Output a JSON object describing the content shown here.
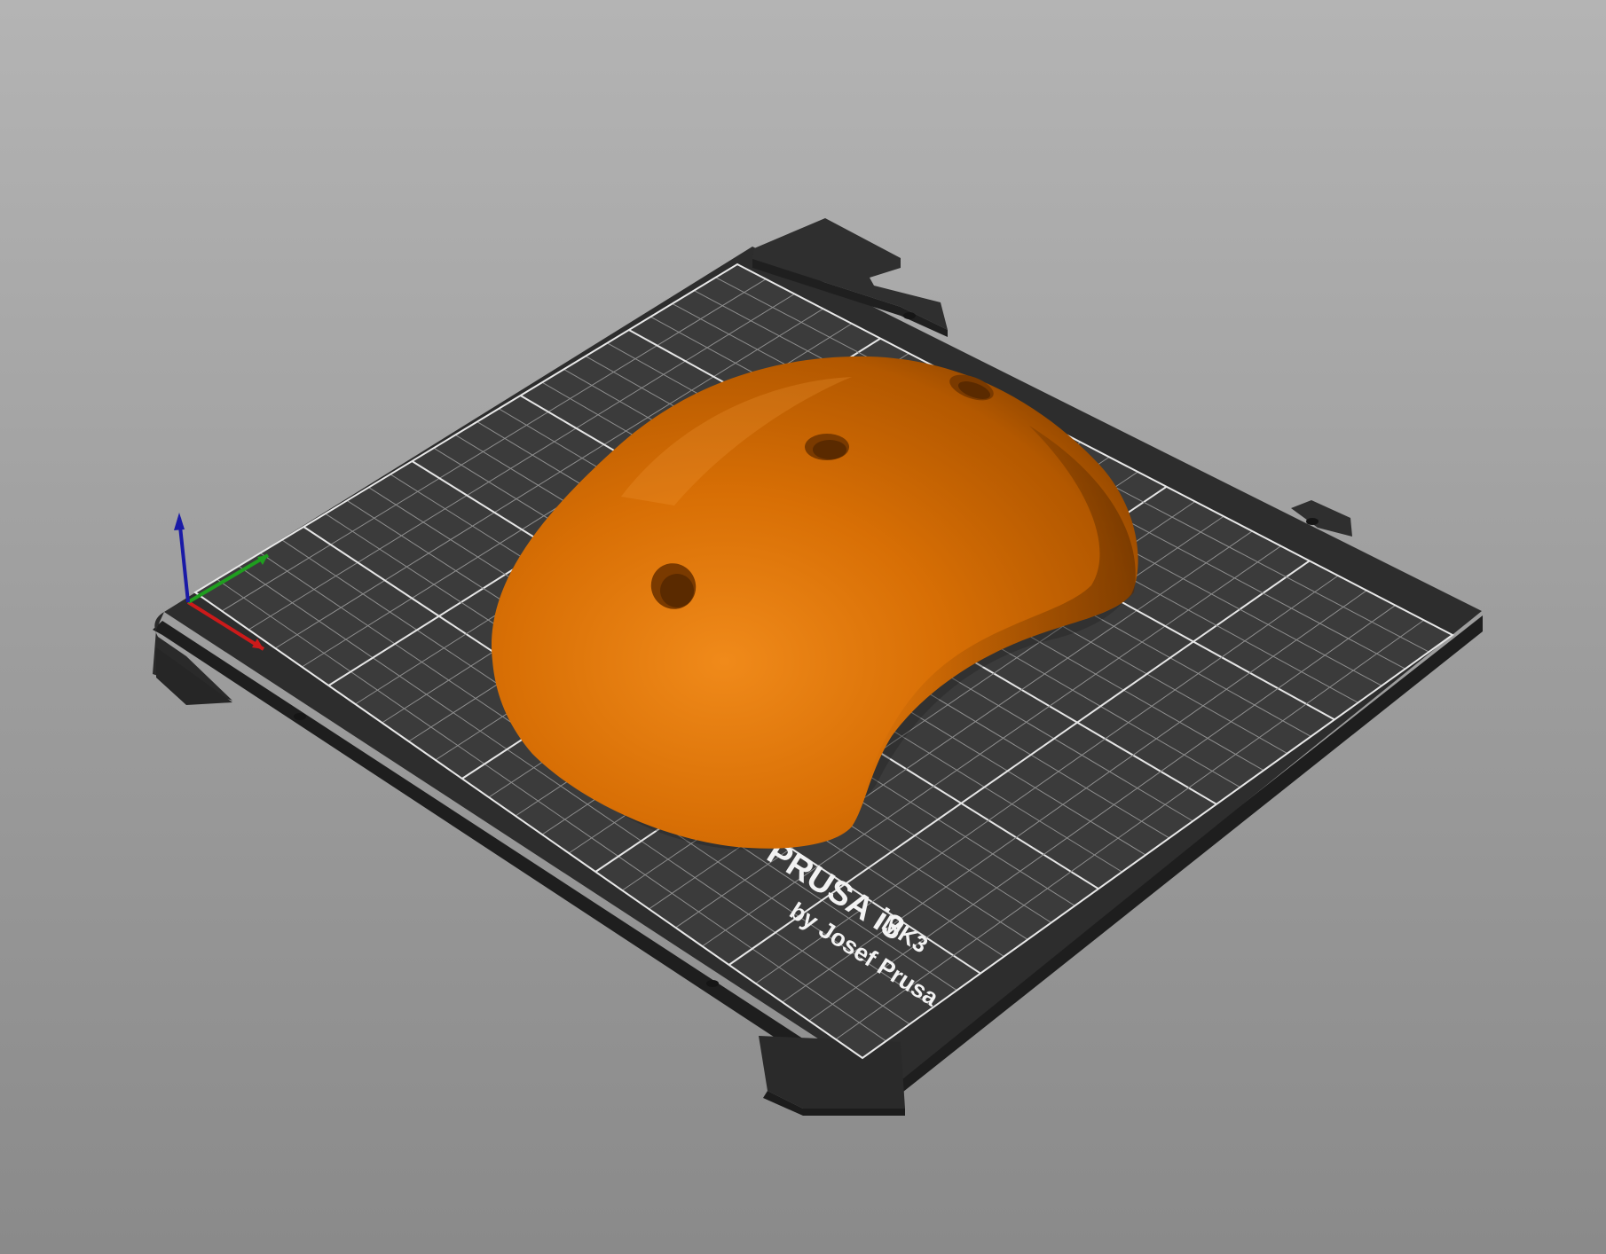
{
  "scene": {
    "background_top": "#b4b4b4",
    "background_bottom": "#8a8a8a",
    "bed": {
      "brand_line": "PRUSA i3",
      "model_tag": "MK3",
      "maker_line": "by Josef Prusa",
      "sheet_color": "#3a3a3a",
      "frame_color": "#2b2b2b",
      "grid_color": "#8e8e8e",
      "major_grid_color": "#e6e6e6"
    },
    "model": {
      "color": "#e07a10",
      "shadow_color": "#6b3300",
      "holes": 3
    },
    "axes": {
      "x_color": "#cc1a1a",
      "y_color": "#1f9e1f",
      "z_color": "#1a1aa6"
    }
  }
}
